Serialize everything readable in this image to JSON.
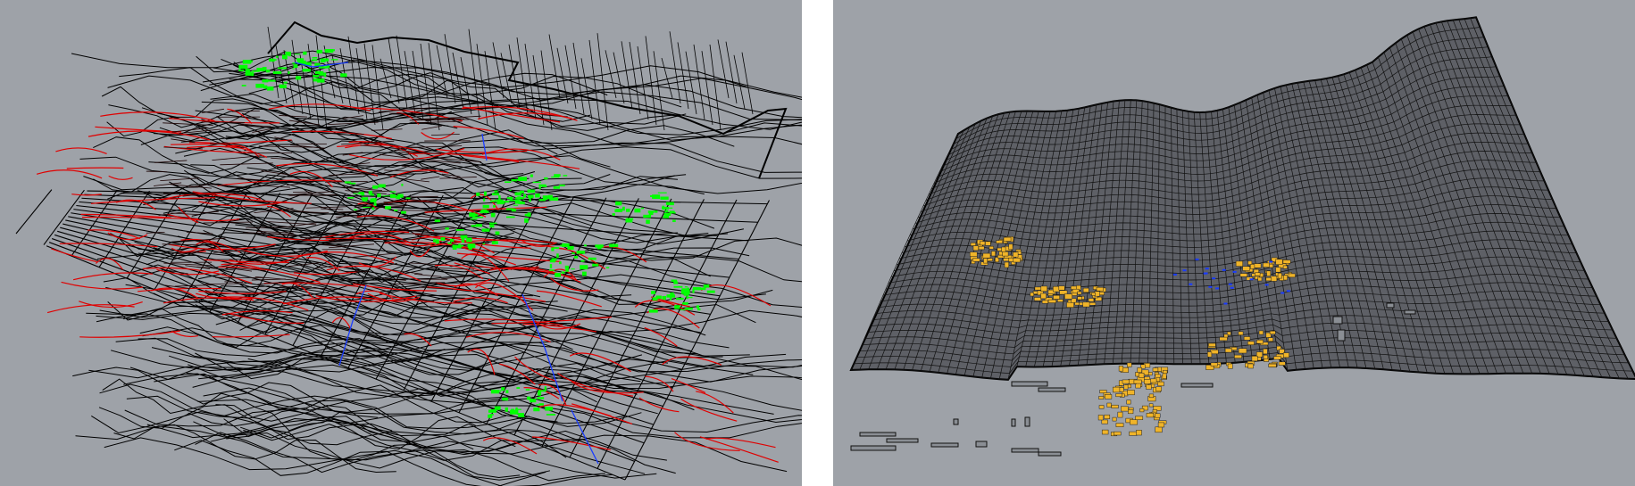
{
  "viewports": [
    {
      "id": "left",
      "description_name": "perspective-viewport-left",
      "colors": {
        "background": "#9ea2a8",
        "contours": "#000000",
        "roads": "#e00000",
        "vegetation": "#00ff00",
        "water": "#1a3cff",
        "grid": "#000000"
      }
    },
    {
      "id": "right",
      "description_name": "perspective-viewport-right",
      "colors": {
        "background": "#9ea2a8",
        "mesh": "#111111",
        "buildings": "#f0b429",
        "building_outlines": "#222222",
        "water": "#1a3cff"
      }
    }
  ]
}
